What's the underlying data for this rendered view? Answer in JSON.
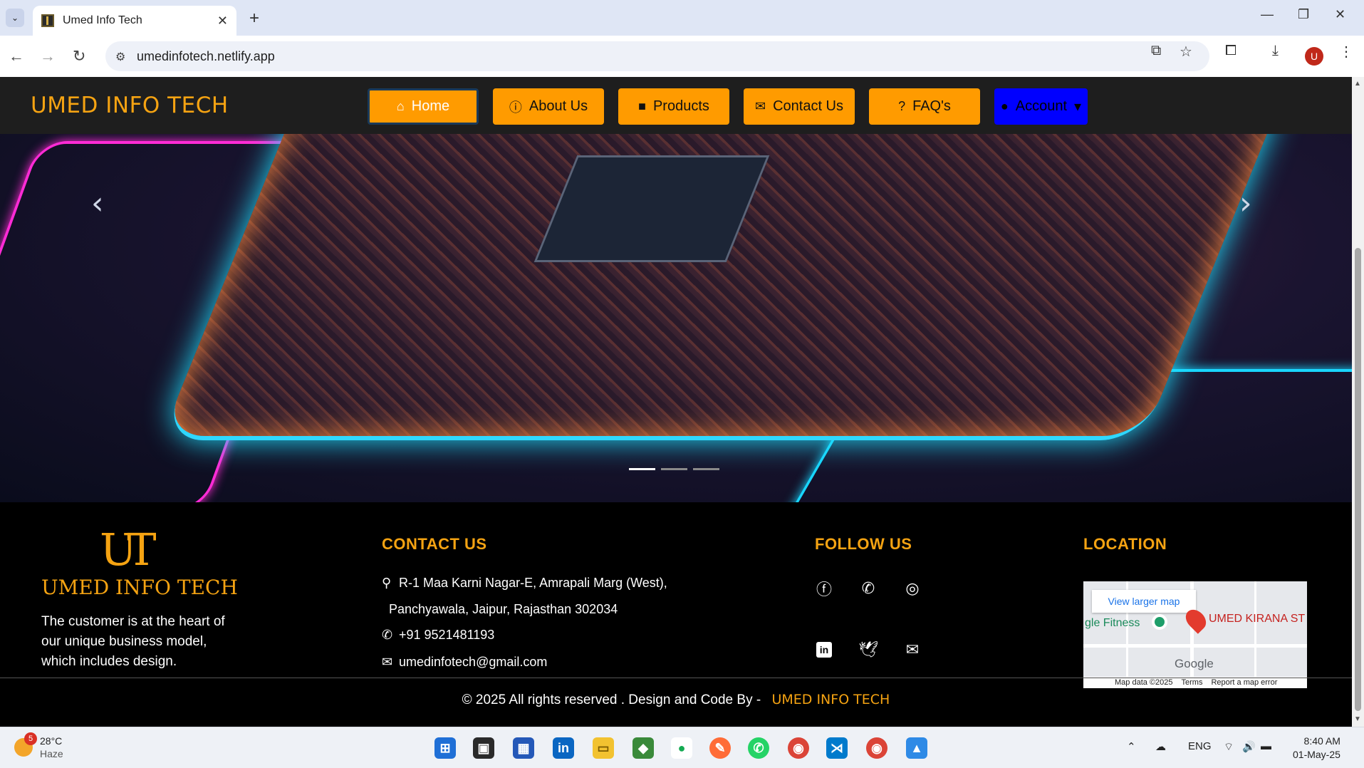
{
  "browser": {
    "tab_title": "Umed Info Tech",
    "url": "umedinfotech.netlify.app",
    "profile_initial": "U"
  },
  "site": {
    "brand": "UMED INFO TECH",
    "nav": [
      {
        "label": "Home",
        "icon": "home-icon"
      },
      {
        "label": "About Us",
        "icon": "info-icon"
      },
      {
        "label": "Products",
        "icon": "briefcase-icon"
      },
      {
        "label": "Contact Us",
        "icon": "envelope-icon"
      },
      {
        "label": "FAQ's",
        "icon": "question-icon"
      },
      {
        "label": "Account",
        "icon": "user-icon"
      }
    ],
    "carousel": {
      "slides": 3,
      "active": 1
    }
  },
  "footer": {
    "logo_mark": "UT",
    "logo_text": "UMED INFO TECH",
    "tagline": "The customer is at the heart of our unique business model, which includes design.",
    "contact_heading": "CONTACT US",
    "address_line1": "R-1 Maa Karni Nagar-E, Amrapali Marg (West),",
    "address_line2": "Panchyawala, Jaipur, Rajasthan 302034",
    "phone": "+91 9521481193",
    "email": "umedinfotech@gmail.com",
    "follow_heading": "FOLLOW US",
    "location_heading": "LOCATION",
    "map": {
      "view_larger": "View larger map",
      "place_left": "gle Fitness",
      "place_right": "UMED KIRANA ST",
      "google": "Google",
      "map_data": "Map data ©2025",
      "terms": "Terms",
      "report": "Report a map error"
    },
    "copyright": "© 2025   All rights reserved .   Design and Code By   -",
    "copyright_brand": "UMED INFO TECH"
  },
  "taskbar": {
    "weather_temp": "28°C",
    "weather_desc": "Haze",
    "weather_badge": "5",
    "lang": "ENG",
    "time": "8:40 AM",
    "date": "01-May-25"
  },
  "colors": {
    "accent": "#ff9b00",
    "brand_text": "#f5a312",
    "account_button": "#0000ff",
    "nav_bg": "#1e1e1e"
  }
}
